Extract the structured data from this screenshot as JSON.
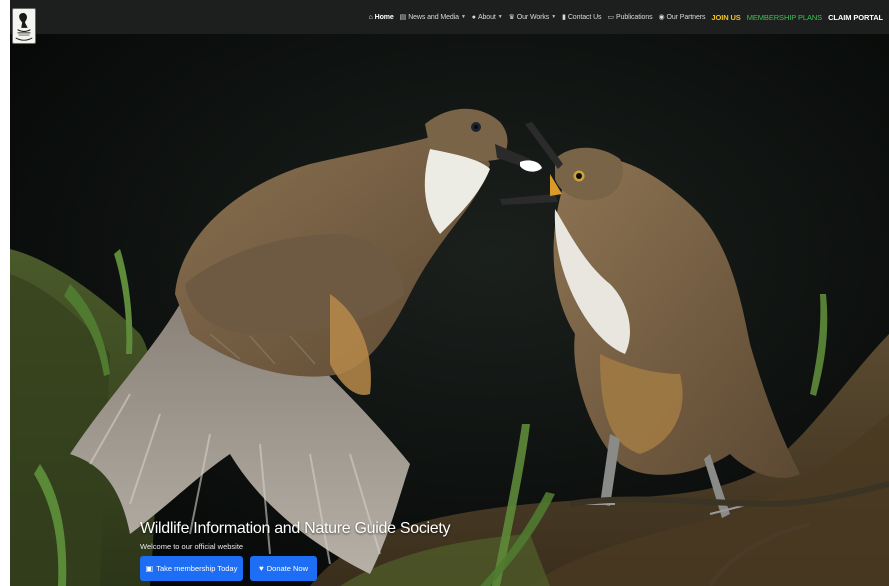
{
  "brand": {
    "logo_icon": "society-crest-icon"
  },
  "nav": {
    "home": {
      "label": "Home",
      "icon": "home-icon"
    },
    "news": {
      "label": "News and Media",
      "icon": "newspaper-icon",
      "has_dropdown": true
    },
    "about": {
      "label": "About",
      "icon": "info-circle-icon",
      "has_dropdown": true
    },
    "works": {
      "label": "Our Works",
      "icon": "trophy-icon",
      "has_dropdown": true
    },
    "contact": {
      "label": "Contact Us",
      "icon": "phone-book-icon"
    },
    "publications": {
      "label": "Publications",
      "icon": "book-icon"
    },
    "partners": {
      "label": "Our Partners",
      "icon": "eye-icon"
    },
    "join": {
      "label": "JOIN US"
    },
    "plans": {
      "label": "MEMBERSHIP PLANS"
    },
    "claim": {
      "label": "CLAIM PORTAL"
    }
  },
  "hero": {
    "title": "Wildlife Information and Nature Guide Society",
    "subtitle": "Welcome to our official website",
    "membership_button": {
      "label": "Take membership Today",
      "icon": "id-card-icon"
    },
    "donate_button": {
      "label": "Donate Now",
      "icon": "hand-heart-icon"
    }
  },
  "colors": {
    "navbar_bg": "#1c1f1d",
    "join_accent": "#f4c21d",
    "plans_accent": "#3cc453",
    "button_primary": "#1e6ef5"
  }
}
